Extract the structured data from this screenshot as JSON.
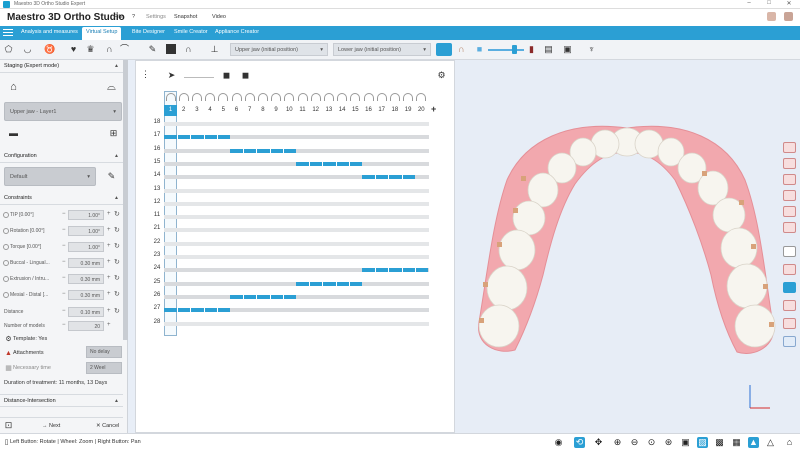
{
  "window": {
    "title": "Maestro 3D Ortho Studio Expert",
    "controls": [
      "–",
      "□",
      "✕"
    ]
  },
  "menubar": {
    "app_name": "Maestro 3D Ortho Studio",
    "items": [
      "File",
      "?",
      "Settings",
      "Snapshot",
      "Video"
    ]
  },
  "tabs": [
    "Analysis and measures",
    "Virtual Setup",
    "Bite Designer",
    "Smile Creator",
    "Appliance Creator"
  ],
  "active_tab": "Virtual Setup",
  "toolbar": {
    "upper_jaw": "Upper jaw (initial position)",
    "lower_jaw": "Lower jaw (initial position)"
  },
  "left_panel": {
    "staging_title": "Staging (Expert mode)",
    "layer_select": "Upper jaw - Layer1",
    "configuration_title": "Configuration",
    "config_select": "Default",
    "constraints_title": "Constraints",
    "constraints": [
      {
        "label": "TIP [0.00°]",
        "value": "1.00°"
      },
      {
        "label": "Rotation [0.00°]",
        "value": "1.00°"
      },
      {
        "label": "Torque [0.00°]",
        "value": "1.00°"
      },
      {
        "label": "Buccal - Lingual...",
        "value": "0.30 mm"
      },
      {
        "label": "Extrusion / Intru...",
        "value": "0.30 mm"
      },
      {
        "label": "Mesial - Distal [...",
        "value": "0.30 mm"
      }
    ],
    "distance_label": "Distance",
    "distance_value": "0.10 mm",
    "models_label": "Number of models",
    "models_value": "20",
    "template_label": "Template: Yes",
    "attachments_label": "Attachments",
    "attachments_value": "No delay",
    "necessary_time_label": "Necessary time",
    "necessary_time_value": "2 Weel",
    "duration": "Duration of treatment: 11 months, 13 Days",
    "distance_intersection": "Distance-Intersection",
    "next_label": "Next",
    "cancel_label": "Cancel"
  },
  "staging": {
    "stages": [
      "1",
      "2",
      "3",
      "4",
      "5",
      "6",
      "7",
      "8",
      "9",
      "10",
      "11",
      "12",
      "13",
      "14",
      "15",
      "16",
      "17",
      "18",
      "19",
      "20"
    ],
    "active_stage": 1,
    "add_label": "+",
    "teeth": [
      {
        "tooth": "18",
        "movement": null
      },
      {
        "tooth": "17",
        "movement": [
          1,
          5
        ]
      },
      {
        "tooth": "16",
        "movement": [
          6,
          10
        ]
      },
      {
        "tooth": "15",
        "movement": [
          11,
          15
        ]
      },
      {
        "tooth": "14",
        "movement": [
          16,
          19
        ]
      },
      {
        "tooth": "13",
        "movement": null
      },
      {
        "tooth": "12",
        "movement": null
      },
      {
        "tooth": "11",
        "movement": null
      },
      {
        "tooth": "21",
        "movement": null
      },
      {
        "tooth": "22",
        "movement": null
      },
      {
        "tooth": "23",
        "movement": null
      },
      {
        "tooth": "24",
        "movement": [
          16,
          20
        ]
      },
      {
        "tooth": "25",
        "movement": [
          11,
          15
        ]
      },
      {
        "tooth": "26",
        "movement": [
          6,
          10
        ]
      },
      {
        "tooth": "27",
        "movement": [
          1,
          5
        ]
      },
      {
        "tooth": "28",
        "movement": null
      }
    ]
  },
  "statusbar": {
    "hint": "Left Button: Rotate | Wheel: Zoom | Right Button: Pan"
  },
  "colors": {
    "accent": "#2b9fd4",
    "gum": "#f2a8ae",
    "tooth": "#f7f5ef",
    "attachment": "#d8a27a"
  }
}
